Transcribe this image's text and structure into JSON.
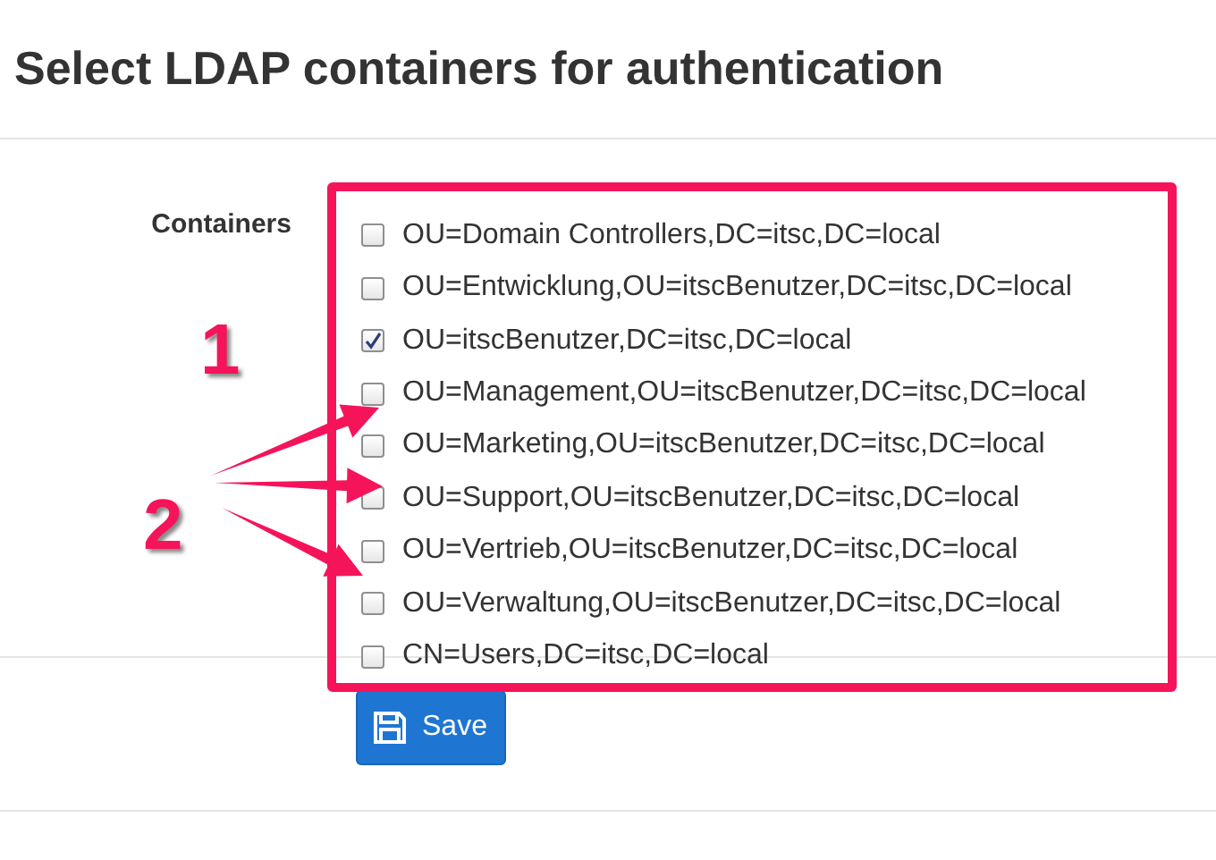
{
  "title": "Select LDAP containers for authentication",
  "field_label": "Containers",
  "containers": [
    {
      "label": "OU=Domain Controllers,DC=itsc,DC=local",
      "checked": false
    },
    {
      "label": "OU=Entwicklung,OU=itscBenutzer,DC=itsc,DC=local",
      "checked": false
    },
    {
      "label": "OU=itscBenutzer,DC=itsc,DC=local",
      "checked": true
    },
    {
      "label": "OU=Management,OU=itscBenutzer,DC=itsc,DC=local",
      "checked": false
    },
    {
      "label": "OU=Marketing,OU=itscBenutzer,DC=itsc,DC=local",
      "checked": false
    },
    {
      "label": "OU=Support,OU=itscBenutzer,DC=itsc,DC=local",
      "checked": false
    },
    {
      "label": "OU=Vertrieb,OU=itscBenutzer,DC=itsc,DC=local",
      "checked": false
    },
    {
      "label": "OU=Verwaltung,OU=itscBenutzer,DC=itsc,DC=local",
      "checked": false
    },
    {
      "label": "CN=Users,DC=itsc,DC=local",
      "checked": false
    }
  ],
  "annotations": [
    {
      "label": "1"
    },
    {
      "label": "2"
    }
  ],
  "save_button": {
    "label": "Save"
  }
}
